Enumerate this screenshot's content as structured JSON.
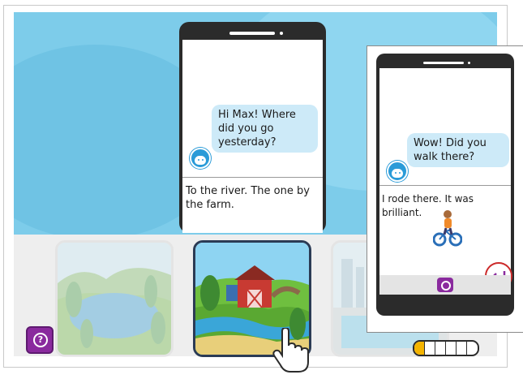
{
  "main_chat": {
    "message": "Hi Max! Where did you go yesterday?",
    "reply": "To the river. The one by the farm."
  },
  "scene_cards": [
    {
      "name": "lake-hills",
      "state": "faded"
    },
    {
      "name": "farm-river",
      "state": "selected"
    },
    {
      "name": "swimming-pool",
      "state": "faded"
    }
  ],
  "help_button": {
    "glyph": "?"
  },
  "progress": {
    "filled_segments": 1,
    "total_segments": 6
  },
  "overlay_chat": {
    "message": "Wow! Did you walk there?",
    "reply": "I rode there. It was brilliant."
  },
  "icons": {
    "avatar": "avatar-icon",
    "camera": "camera-icon",
    "enter": "enter-icon",
    "help": "help-icon",
    "pointer": "hand-pointer-icon",
    "bicycle": "bicycle-icon"
  },
  "colors": {
    "sky": "#7dccea",
    "bubble": "#cdeaf8",
    "accent_purple": "#8a2a9e",
    "enter_red": "#cc2a2a",
    "progress_fill": "#f4b400"
  }
}
